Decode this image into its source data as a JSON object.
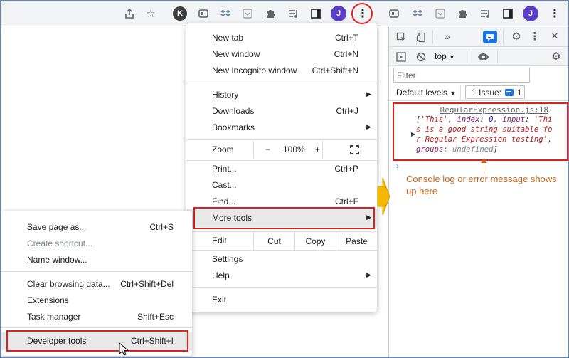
{
  "toolbar": {
    "profile_letter": "J",
    "k_letter": "K",
    "icons": [
      "share-icon",
      "star-icon",
      "k-extension-icon",
      "extension-icon",
      "dropbox-icon",
      "pocket-icon",
      "puzzle-icon",
      "reading-list-icon",
      "side-panel-icon",
      "profile-avatar",
      "kebab-menu-icon"
    ]
  },
  "main_menu": {
    "items": [
      {
        "label": "New tab",
        "shortcut": "Ctrl+T"
      },
      {
        "label": "New window",
        "shortcut": "Ctrl+N"
      },
      {
        "label": "New Incognito window",
        "shortcut": "Ctrl+Shift+N"
      },
      {
        "label": "History",
        "shortcut": ""
      },
      {
        "label": "Downloads",
        "shortcut": "Ctrl+J"
      },
      {
        "label": "Bookmarks",
        "shortcut": ""
      },
      {
        "label": "Print...",
        "shortcut": "Ctrl+P"
      },
      {
        "label": "Cast...",
        "shortcut": ""
      },
      {
        "label": "Find...",
        "shortcut": "Ctrl+F"
      },
      {
        "label": "More tools",
        "shortcut": ""
      },
      {
        "label": "Settings",
        "shortcut": ""
      },
      {
        "label": "Help",
        "shortcut": ""
      },
      {
        "label": "Exit",
        "shortcut": ""
      }
    ],
    "zoom": {
      "label": "Zoom",
      "minus": "−",
      "value": "100%",
      "plus": "+"
    },
    "edit": {
      "label": "Edit",
      "cut": "Cut",
      "copy": "Copy",
      "paste": "Paste"
    }
  },
  "sub_menu": {
    "items": [
      {
        "label": "Save page as...",
        "shortcut": "Ctrl+S"
      },
      {
        "label": "Create shortcut...",
        "shortcut": ""
      },
      {
        "label": "Name window...",
        "shortcut": ""
      },
      {
        "label": "Clear browsing data...",
        "shortcut": "Ctrl+Shift+Del"
      },
      {
        "label": "Extensions",
        "shortcut": ""
      },
      {
        "label": "Task manager",
        "shortcut": "Shift+Esc"
      },
      {
        "label": "Developer tools",
        "shortcut": "Ctrl+Shift+I"
      }
    ]
  },
  "devtools": {
    "context": "top",
    "filter_placeholder": "Filter",
    "levels": "Default levels",
    "issues_label": "1 Issue:",
    "issues_count": "1",
    "log": {
      "source": "RegularExpression.js:18",
      "v0": "'This'",
      "k1": "index",
      "v1": "0",
      "k2": "input",
      "v2": "'This is a good string suitable for Regular Expression testing'",
      "k3": "groups",
      "v3": "undefined"
    },
    "annotation": "Console log or error message shows up here"
  },
  "colors": {
    "highlight_red": "#e02020",
    "annotation_orange": "#c8651b",
    "arrow_yellow": "#f5b800",
    "avatar_purple": "#5b3fc4"
  }
}
